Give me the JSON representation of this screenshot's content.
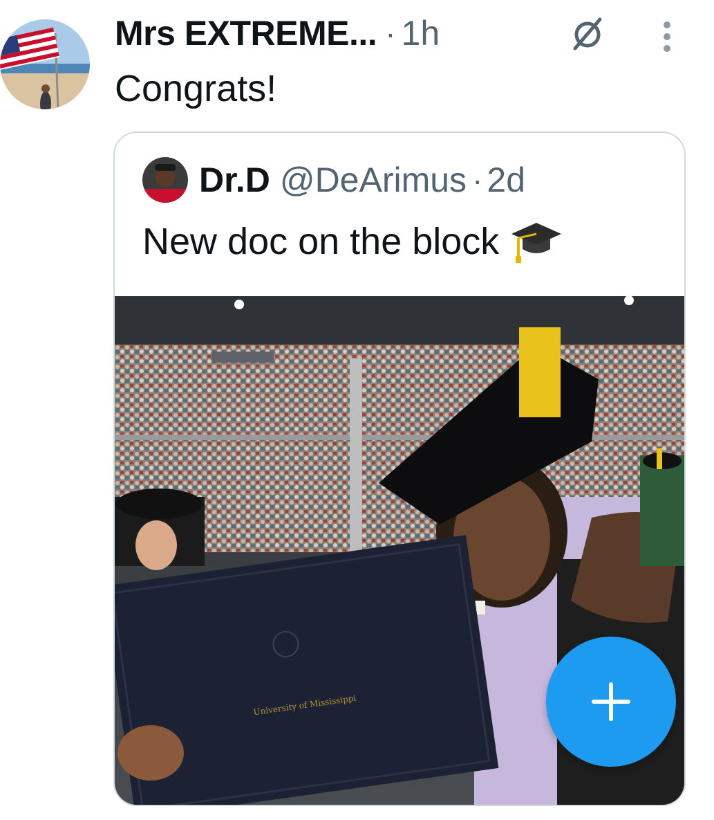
{
  "author": {
    "name": "Mrs EXTREME...",
    "separator": "·",
    "time": "1h",
    "avatar_icon": "flag-beach-avatar"
  },
  "tweet": {
    "text": "Congrats!"
  },
  "icons": {
    "grok": "grok-slash-icon",
    "more": "more-vertical-icon",
    "compose": "plus-icon"
  },
  "quote": {
    "name": "Dr.D",
    "handle": "@DeArimus",
    "separator": "·",
    "time": "2d",
    "text": "New doc on the block",
    "emoji_icon": "graduation-cap-icon"
  },
  "media": {
    "diploma_text": "University of Mississippi"
  },
  "colors": {
    "accent": "#1d9bf0",
    "secondary_text": "#536471",
    "border": "#cfd9de"
  }
}
